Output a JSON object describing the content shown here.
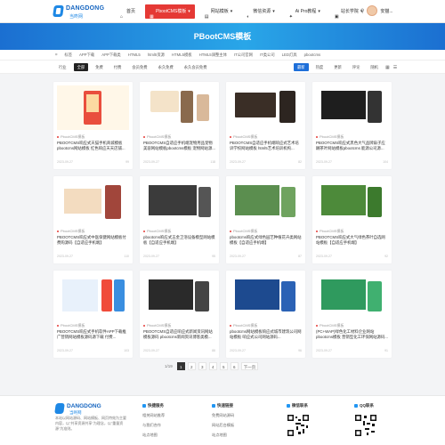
{
  "header": {
    "logo_text": "DANGDONG",
    "logo_sub": "当咚网",
    "nav": [
      {
        "label": "首页",
        "active": false
      },
      {
        "label": "PbootCMS模板",
        "active": true
      },
      {
        "label": "网站模板",
        "active": false
      },
      {
        "label": "微信资源",
        "active": false
      },
      {
        "label": "Ai Pro教程",
        "active": false
      },
      {
        "label": "站长学院",
        "active": false
      }
    ],
    "user_label": "安猫..."
  },
  "banner": {
    "title": "PBootCMS模板"
  },
  "tags": [
    "标签",
    "APP下载",
    "APP下载类",
    "HTML5",
    "html5资源",
    "HTML5模板",
    "HTML5调整主体",
    "IT公司官网",
    "IT类公司",
    "LED灯具",
    "pbootcms"
  ],
  "filters": {
    "left": [
      {
        "label": "行业",
        "active": false
      },
      {
        "label": "全部",
        "active": true
      },
      {
        "label": "免费",
        "active": false
      },
      {
        "label": "付费",
        "active": false
      },
      {
        "label": "会员免费",
        "active": false
      },
      {
        "label": "永久免费",
        "active": false
      },
      {
        "label": "永久会员免费",
        "active": false
      }
    ],
    "right": [
      {
        "label": "最新",
        "active": true
      },
      {
        "label": "热度",
        "active": false
      },
      {
        "label": "更新",
        "active": false
      },
      {
        "label": "评论",
        "active": false
      },
      {
        "label": "随机",
        "active": false
      }
    ]
  },
  "cards": [
    {
      "cat": "PbootCMS模板",
      "title": "PBOOTCMS响应式天猫手机商城模板pbootcms网站模板 红色响应天天店铺...",
      "meta": "2023-09-27",
      "views": "99"
    },
    {
      "cat": "PbootCMS模板",
      "title": "PBOOTCMS自适应手机端宠物用品宠物美容网站模板pbootcms模板 宠物网站源...",
      "meta": "2023-09-27",
      "views": "118"
    },
    {
      "cat": "PbootCMS模板",
      "title": "PBOOTCMS自适应手机端响应式艺术培训学校网站模板 html5艺术培训机构...",
      "meta": "2023-09-27",
      "views": "82"
    },
    {
      "cat": "PbootCMS模板",
      "title": "PBOOTCMS响应式黑色大气品牌扇子应酬茶叶网站模板pbootcms 能源公司源...",
      "meta": "2023-09-27",
      "views": "104"
    },
    {
      "cat": "PbootCMS模板",
      "title": "PBOOTCMS响应式中医保健网站模板付费购源码【自适应手机端】",
      "meta": "2023-09-27",
      "views": "110"
    },
    {
      "cat": "PbootCMS模板",
      "title": "pbootcms响应式五金卫浴设备模型网站模板【自适应手机端】",
      "meta": "2023-09-27",
      "views": "95"
    },
    {
      "cat": "PbootCMS模板",
      "title": "pbootcms响应式绿色园艺种植花卉类网站模板【自适应手机端】",
      "meta": "2023-09-27",
      "views": "87"
    },
    {
      "cat": "PbootCMS模板",
      "title": "PBOOTCMS响应式大气绿色茶叶自选网站模板【自适应手机端】",
      "meta": "2023-09-27",
      "views": "92"
    },
    {
      "cat": "PbootCMS模板",
      "title": "PBOOTCMS响应式手机软件APP下载推广营销网站模板源码源下载 付费...",
      "meta": "2023-09-27",
      "views": "103"
    },
    {
      "cat": "PbootCMS模板",
      "title": "PBOOTCMS自适应响应式新闻资讯网站模板源码 pbootcms新闻资讯博客类模...",
      "meta": "2023-09-27",
      "views": "88"
    },
    {
      "cat": "PbootCMS模板",
      "title": "pbootcms网站模板响应式城市建筑公司网站模板 响应式公司网站源码...",
      "meta": "2023-09-27",
      "views": "96"
    },
    {
      "cat": "PbootCMS模板",
      "title": "(PC+WAP)绿色化工材料企业网站pbootcms模板 营销型化工环保网站源码...",
      "meta": "2023-09-27",
      "views": "91"
    }
  ],
  "pager": {
    "info": "1/19",
    "pages": [
      "1",
      "2",
      "3",
      "4",
      "5",
      "6"
    ],
    "next": "下一页"
  },
  "footer": {
    "desc": "本站以网站源码、网站模板、网页特效为主要内容，以\"共享资源共享\"为理念，以\"重量资源\"为准则。",
    "col1": {
      "title": "快捷服务",
      "links": [
        "相关网站推荐",
        "与我们合作",
        "站点地图"
      ]
    },
    "col2": {
      "title": "快速链接",
      "links": [
        "免费网站源码",
        "网站后台模板",
        "站点地图"
      ]
    },
    "col3": {
      "title": "微信联系"
    },
    "col4": {
      "title": "QQ联系"
    }
  },
  "colors": {
    "accent": "#e53935",
    "brand": "#1e6fd9",
    "banner_start": "#1b6fd1",
    "banner_mid": "#29a6e8"
  }
}
